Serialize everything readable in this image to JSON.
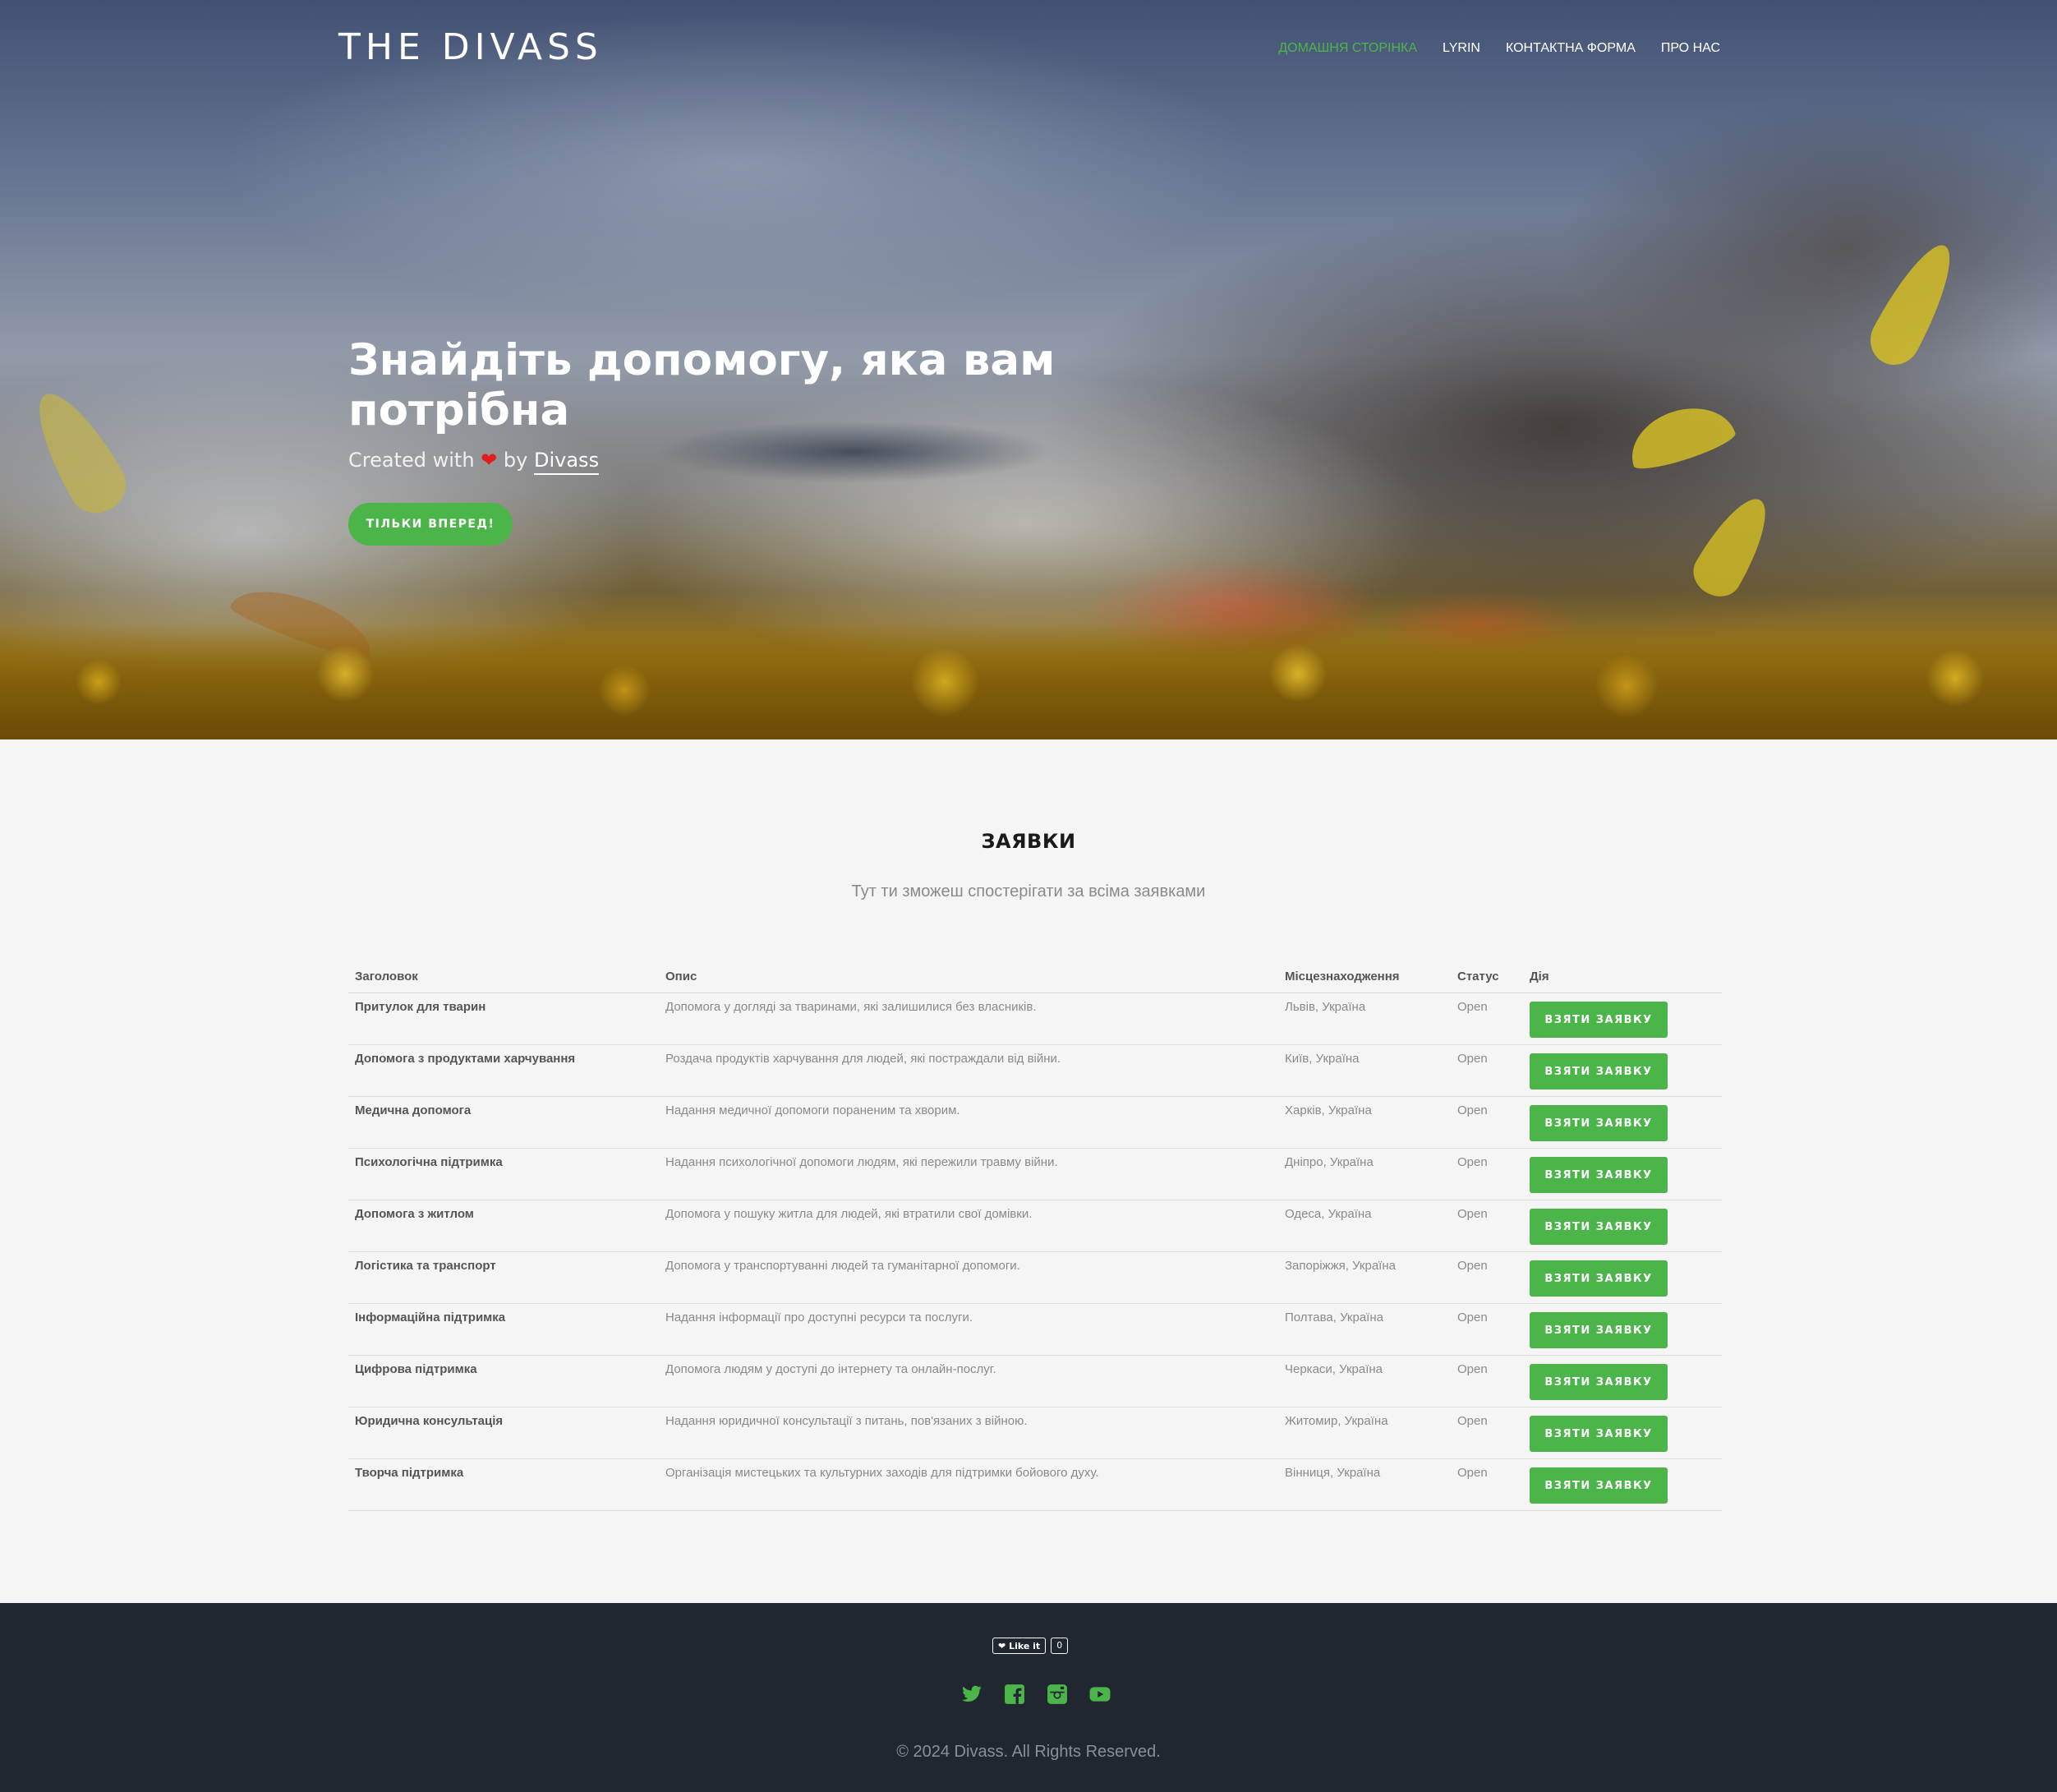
{
  "header": {
    "logo": "THE DIVASS",
    "nav": [
      {
        "label": "Домашня сторінка",
        "active": true
      },
      {
        "label": "LYRIN",
        "active": false
      },
      {
        "label": "Контактна форма",
        "active": false
      },
      {
        "label": "Про нас",
        "active": false
      }
    ]
  },
  "hero": {
    "title": "Знайдіть допомогу, яка вам потрібна",
    "created_prefix": "Created with",
    "heart_icon": "heart-icon",
    "created_by": "by",
    "author": "Divass",
    "cta_label": "ТІЛЬКИ ВПЕРЕД!"
  },
  "requests": {
    "title": "ЗАЯВКИ",
    "subtitle": "Тут ти зможеш спостерігати за всіма заявками",
    "columns": [
      "Заголовок",
      "Опис",
      "Місцезнаходження",
      "Статус",
      "Дія"
    ],
    "action_label": "Взяти заявку",
    "rows": [
      {
        "title": "Притулок для тварин",
        "description": "Допомога у догляді за тваринами, які залишилися без власників.",
        "location": "Львів, Україна",
        "status": "Open"
      },
      {
        "title": "Допомога з продуктами харчування",
        "description": "Роздача продуктів харчування для людей, які постраждали від війни.",
        "location": "Київ, Україна",
        "status": "Open"
      },
      {
        "title": "Медична допомога",
        "description": "Надання медичної допомоги пораненим та хворим.",
        "location": "Харків, Україна",
        "status": "Open"
      },
      {
        "title": "Психологічна підтримка",
        "description": "Надання психологічної допомоги людям, які пережили травму війни.",
        "location": "Дніпро, Україна",
        "status": "Open"
      },
      {
        "title": "Допомога з житлом",
        "description": "Допомога у пошуку житла для людей, які втратили свої домівки.",
        "location": "Одеса, Україна",
        "status": "Open"
      },
      {
        "title": "Логістика та транспорт",
        "description": "Допомога у транспортуванні людей та гуманітарної допомоги.",
        "location": "Запоріжжя, Україна",
        "status": "Open"
      },
      {
        "title": "Інформаційна підтримка",
        "description": "Надання інформації про доступні ресурси та послуги.",
        "location": "Полтава, Україна",
        "status": "Open"
      },
      {
        "title": "Цифрова підтримка",
        "description": "Допомога людям у доступі до інтернету та онлайн-послуг.",
        "location": "Черкаси, Україна",
        "status": "Open"
      },
      {
        "title": "Юридична консультація",
        "description": "Надання юридичної консультації з питань, пов'язаних з війною.",
        "location": "Житомир, Україна",
        "status": "Open"
      },
      {
        "title": "Творча підтримка",
        "description": "Організація мистецьких та культурних заходів для підтримки бойового духу.",
        "location": "Вінниця, Україна",
        "status": "Open"
      }
    ]
  },
  "footer": {
    "like_label": "Like it",
    "like_count": "0",
    "socials": [
      "twitter-icon",
      "facebook-icon",
      "instagram-icon",
      "youtube-icon"
    ],
    "copyright": "© 2024 Divass. All Rights Reserved."
  },
  "colors": {
    "accent": "#4bb54a",
    "footer_bg": "#212730",
    "page_bg": "#f5f5f5",
    "heart": "#e11d1d"
  }
}
